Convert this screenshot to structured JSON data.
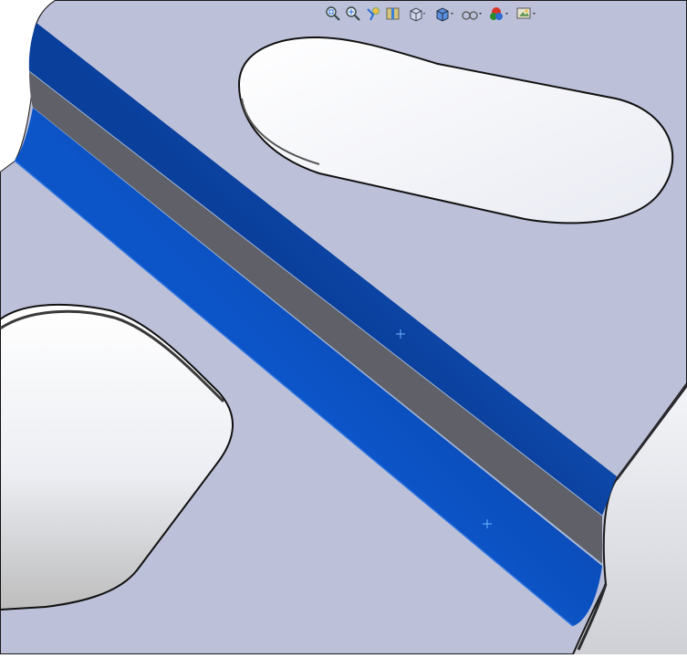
{
  "app": {
    "context": "cad-graphics-area"
  },
  "toolbar": {
    "buttons": [
      {
        "name": "zoom-to-fit-icon",
        "dropdown": false
      },
      {
        "name": "zoom-to-area-icon",
        "dropdown": false
      },
      {
        "name": "previous-view-icon",
        "dropdown": false
      },
      {
        "name": "section-view-icon",
        "dropdown": false
      },
      {
        "name": "view-orientation-icon",
        "dropdown": true
      },
      {
        "name": "display-style-icon",
        "dropdown": true
      },
      {
        "name": "hide-show-items-icon",
        "dropdown": true
      },
      {
        "name": "edit-appearance-icon",
        "dropdown": true
      },
      {
        "name": "apply-scene-icon",
        "dropdown": true
      }
    ]
  },
  "colors": {
    "face": "#BCC1D9",
    "edge": "#1A1A1A",
    "selected_face": "#1A5FD0",
    "side_face": "#5F6068",
    "background": "#FFFFFF"
  }
}
